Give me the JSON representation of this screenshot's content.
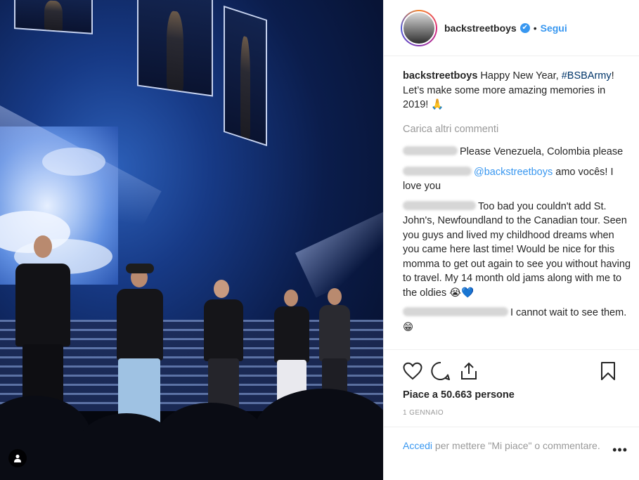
{
  "header": {
    "username": "backstreetboys",
    "verified_glyph": "✔",
    "separator": "•",
    "follow_label": "Segui"
  },
  "caption": {
    "username": "backstreetboys",
    "text_before": "Happy New Year, ",
    "hashtag": "#BSBArmy",
    "text_after": "! Let’s make some more amazing memories in 2019!",
    "emoji": "🙏"
  },
  "load_more": "Carica altri commenti",
  "comments": [
    {
      "username_blurred": true,
      "mention": "",
      "text": "Please Venezuela, Colombia please",
      "emojis": []
    },
    {
      "username_blurred": true,
      "mention": "@backstreetboys",
      "text": " amo vocês! I love you",
      "emojis": []
    },
    {
      "username_blurred": true,
      "mention": "",
      "text": "Too bad you couldn't add St. John's, Newfoundland to the Canadian tour. Seen you guys and lived my childhood dreams when you came here last time! Would be nice for this momma to get out again to see you without having to travel. My 14 month old jams along with me to the oldies",
      "emojis": [
        "😭",
        "💙"
      ]
    },
    {
      "username_blurred": true,
      "mention": "",
      "text": "I cannot wait to see them.",
      "emojis": [
        "😁"
      ]
    }
  ],
  "actions": {
    "like_icon": "heart-icon",
    "comment_icon": "comment-icon",
    "share_icon": "share-icon",
    "save_icon": "bookmark-icon"
  },
  "likes": "Piace a 50.663 persone",
  "date": "1 GENNAIO",
  "login": {
    "link": "Accedi",
    "text": " per mettere \"Mi piace\" o commentare.",
    "more_glyph": "•••"
  },
  "colors": {
    "accent": "#3897f0",
    "hashtag": "#003569",
    "muted": "#999999"
  }
}
